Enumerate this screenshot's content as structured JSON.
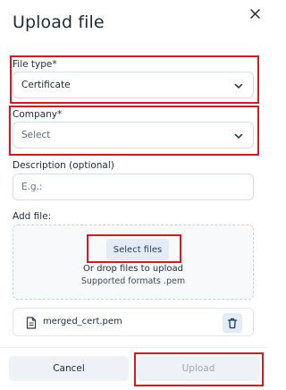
{
  "dialog": {
    "title": "Upload file",
    "close_icon": "close-icon"
  },
  "file_type": {
    "label": "File type*",
    "value": "Certificate",
    "icon": "chevron-down-icon"
  },
  "company": {
    "label": "Company*",
    "placeholder": "Select",
    "icon": "chevron-down-icon"
  },
  "description": {
    "label": "Description (optional)",
    "placeholder": "E.g.:",
    "value": ""
  },
  "add_file": {
    "label": "Add file:",
    "select_button": "Select files",
    "drop_text": "Or drop files to upload",
    "formats_text": "Supported formats .pem"
  },
  "attached_file": {
    "name": "merged_cert.pem",
    "icon": "document-icon",
    "delete_icon": "trash-icon"
  },
  "footer": {
    "cancel_label": "Cancel",
    "upload_label": "Upload"
  },
  "colors": {
    "highlight": "#e0161f",
    "button_bg": "#eef2f6",
    "accent_bg": "#e3ecf6",
    "disabled_text": "#9aa6b3"
  }
}
